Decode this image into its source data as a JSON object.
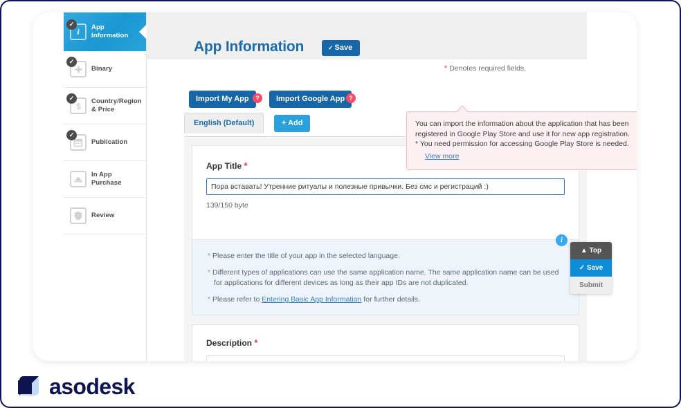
{
  "sidebar": {
    "items": [
      {
        "label": "App\nInformation",
        "icon": "info-italic-icon",
        "checked": true,
        "active": true
      },
      {
        "label": "Binary",
        "icon": "plus-icon",
        "checked": true,
        "active": false
      },
      {
        "label": "Country/Region\n& Price",
        "icon": "dollar-icon",
        "checked": true,
        "active": false
      },
      {
        "label": "Publication",
        "icon": "calendar-icon",
        "checked": true,
        "active": false
      },
      {
        "label": "In App\nPurchase",
        "icon": "cart-icon",
        "checked": false,
        "active": false
      },
      {
        "label": "Review",
        "icon": "shield-icon",
        "checked": false,
        "active": false
      }
    ]
  },
  "header": {
    "title": "App Information",
    "save_label": "Save",
    "save_check": "✓",
    "required_note": "Denotes required fields.",
    "asterisk": "*"
  },
  "toolbar": {
    "import_my_app": "Import My App",
    "import_google_app": "Import Google App",
    "help_glyph": "?"
  },
  "language": {
    "tab_label": "English (Default)",
    "add_label": "+ Add"
  },
  "tooltip": {
    "line1": "You can import the information about the application that has been",
    "line2": "registered in Google Play Store and use it for new app registration.",
    "line3": "* You need permission for accessing Google Play Store is needed.",
    "link": "View more"
  },
  "app_title_field": {
    "label": "App Title",
    "asterisk": "*",
    "value": "Пора вставать! Утренние ритуалы и полезные привычки. Без смс и регистраций :)",
    "byte_count": "139/150 byte",
    "info_glyph": "i"
  },
  "notes": {
    "bullet": "*",
    "line1": "Please enter the title of your app in the selected language.",
    "line2": "Different types of applications can use the same application name. The same application name can be used for applications for different devices as long as their app IDs are not duplicated.",
    "line3_pre": "Please refer to ",
    "line3_link": "Entering Basic App Information",
    "line3_post": " for further details."
  },
  "description_field": {
    "label": "Description",
    "asterisk": "*",
    "value": ""
  },
  "action_box": {
    "top_label": "▲ Top",
    "save_label": "✓ Save",
    "submit_label": "Submit"
  },
  "brand": {
    "name": "asodesk"
  },
  "colors": {
    "accent_blue": "#1766a8",
    "active_blue": "#29a3da",
    "help_red": "#fa4a63",
    "tooltip_bg": "#fdf0f3",
    "tooltip_border": "#f4b8c6",
    "brand_navy": "#0d1450",
    "brand_light": "#c3d9f5"
  }
}
